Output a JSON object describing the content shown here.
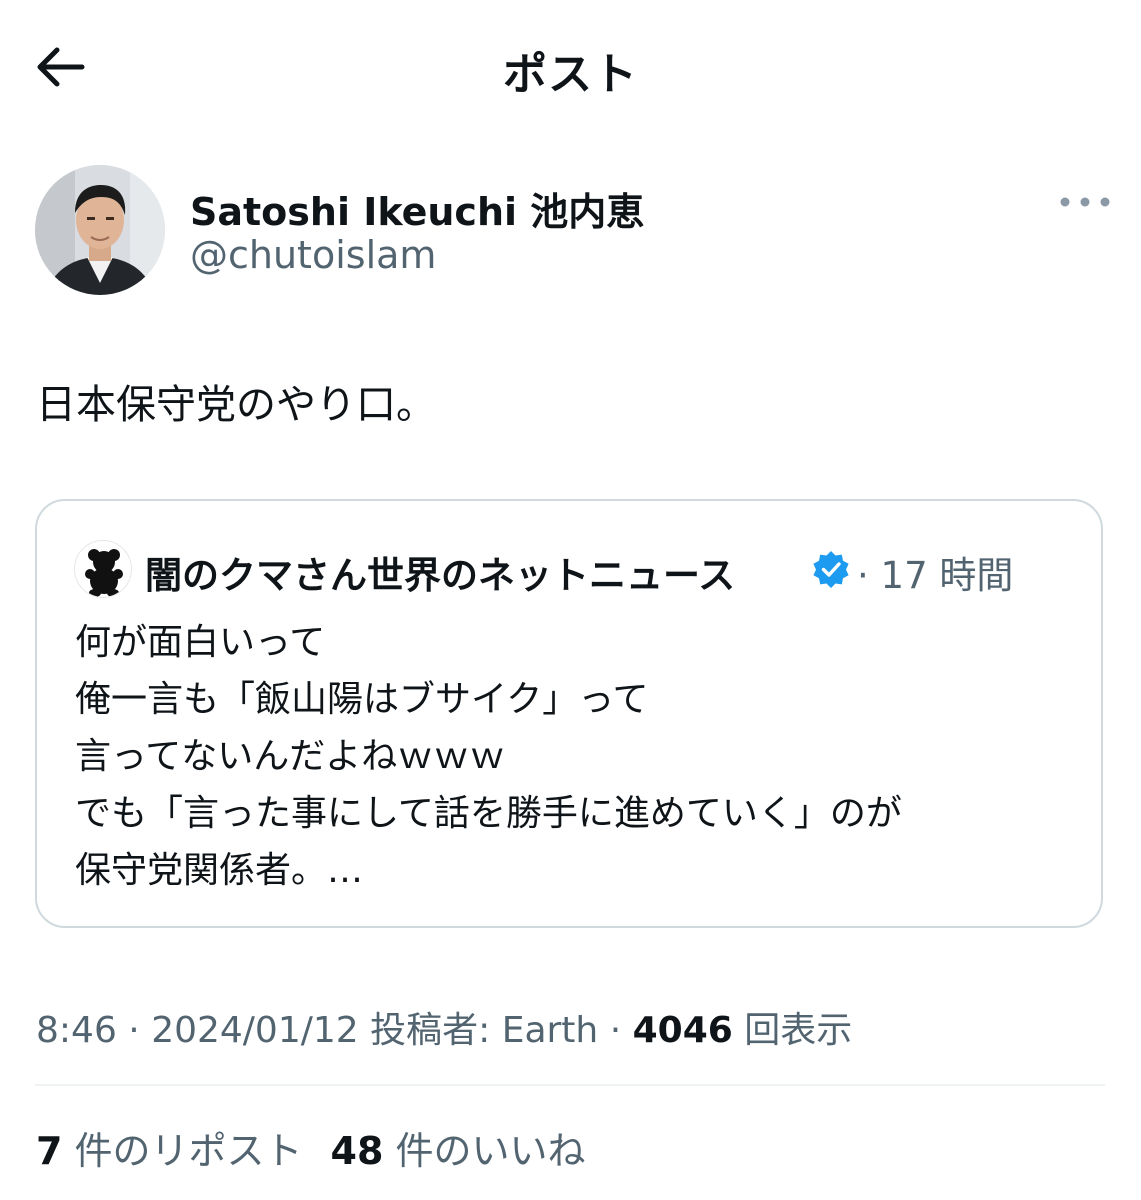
{
  "header": {
    "title": "ポスト",
    "back_icon": "arrow-left-icon"
  },
  "author": {
    "display_name": "Satoshi Ikeuchi 池内恵",
    "handle": "@chutoislam",
    "more_icon": "more-horizontal-icon"
  },
  "post": {
    "text": "日本保守党のやり口。"
  },
  "quote": {
    "avatar_icon": "bear-icon",
    "name": "闇のクマさん世界のネットニュース",
    "verified_icon": "verified-badge-icon",
    "time": "· 17 時間",
    "lines": [
      "何が面白いって",
      "俺一言も「飯山陽はブサイク」って",
      "言ってないんだよねｗｗｗ",
      "でも「言った事にして話を勝手に進めていく」のが",
      "保守党関係者。…"
    ]
  },
  "meta": {
    "time": "8:46",
    "sep1": " · ",
    "date": "2024/01/12",
    "source_label": " 投稿者: Earth",
    "sep2": " · ",
    "views_count": "4046",
    "views_label": " 回表示"
  },
  "stats": {
    "reposts_count": "7",
    "reposts_label": " 件のリポスト",
    "likes_count": "48",
    "likes_label": " 件のいいね"
  },
  "colors": {
    "text_primary": "#0f1419",
    "text_secondary": "#536471",
    "border": "#cfd9de",
    "verified": "#1d9bf0"
  }
}
